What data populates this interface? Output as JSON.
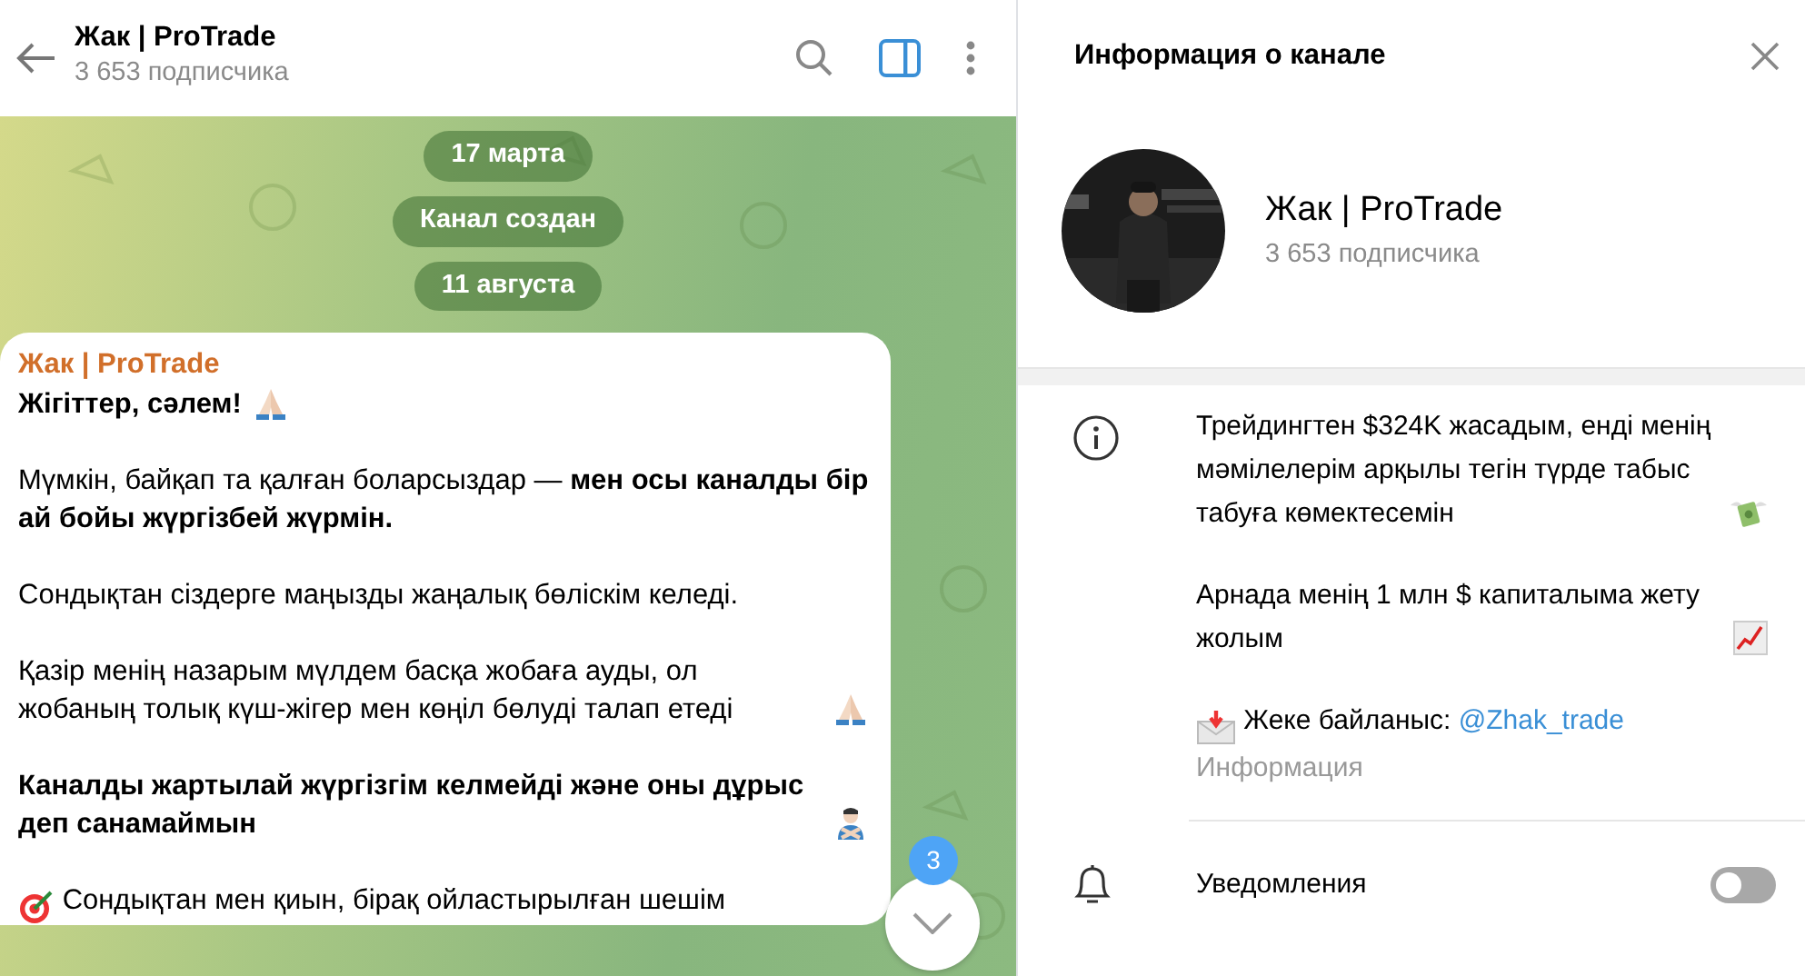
{
  "chat_header": {
    "title": "Жак | ProTrade",
    "subtitle": "3 653 подписчика",
    "side_panel_open": true
  },
  "service_messages": [
    {
      "text": "17 марта"
    },
    {
      "text": "Канал создан"
    },
    {
      "text": "11 августа"
    }
  ],
  "message": {
    "author": "Жак | ProTrade",
    "paragraphs": [
      {
        "text": "**Жігіттер, сәлем!**",
        "icon_after": {
          "kind": "pray"
        }
      },
      {
        "text": "Мүмкін, байқап та қалған боларсыздар — **мен осы каналды бір ай бойы жүргізбей жүрмін.**"
      },
      {
        "text": "Сондықтан сіздерге маңызды жаңалық бөліскім келеді."
      },
      {
        "text": "Қазір менің назарым мүлдем басқа жобаға ауды, ол жобаның толық күш-жігер мен көңіл бөлуді талап етеді",
        "icon_after": {
          "kind": "pray"
        }
      },
      {
        "text": "**Каналды жартылай жүргізгім келмейді және оны дұрыс деп санамаймын**",
        "icon_after": {
          "kind": "crossed-arms"
        }
      },
      {
        "text": "Сондықтан мен қиын, бірақ ойластырылған шешім",
        "icon_before": {
          "kind": "target"
        }
      }
    ]
  },
  "scroll_down": {
    "unread_count": "3"
  },
  "info_panel": {
    "title": "Информация о канале",
    "name": "Жак | ProTrade",
    "subscribers": "3 653 подписчика",
    "description": [
      {
        "text": "Трейдингтен $324K жасадым, енді менің мәмілелерім арқылы тегін түрде табыс табуға көмектесемін",
        "icon_after": {
          "kind": "money"
        }
      },
      {
        "text": "Арнада менің 1 млн $ капиталыма жету жолым",
        "icon_after": {
          "kind": "chart"
        }
      },
      {
        "text": "Жеке байланыс:",
        "icon_before": {
          "kind": "envelope"
        },
        "link": "@Zhak_trade"
      }
    ],
    "description_label": "Информация",
    "notifications": {
      "label": "Уведомления",
      "on": false
    }
  }
}
